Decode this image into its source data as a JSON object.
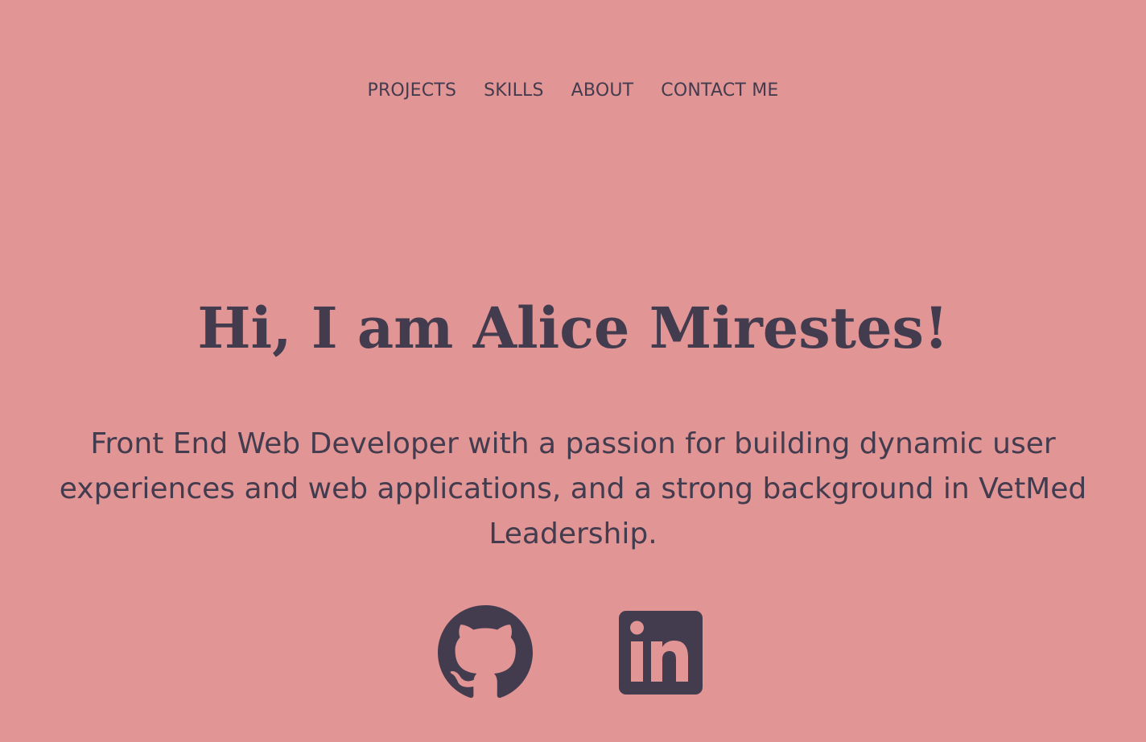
{
  "nav": {
    "items": [
      {
        "label": "PROJECTS"
      },
      {
        "label": "SKILLS"
      },
      {
        "label": "ABOUT"
      },
      {
        "label": "CONTACT ME"
      }
    ]
  },
  "hero": {
    "title": "Hi, I am Alice Mirestes!",
    "subtitle": "Front End Web Developer with a passion for building dynamic user experiences and web applications, and a strong background in VetMed Leadership."
  },
  "socials": [
    {
      "icon": "github-icon"
    },
    {
      "icon": "linkedin-icon"
    }
  ],
  "colors": {
    "background": "#e29595",
    "text": "#433c4f"
  }
}
